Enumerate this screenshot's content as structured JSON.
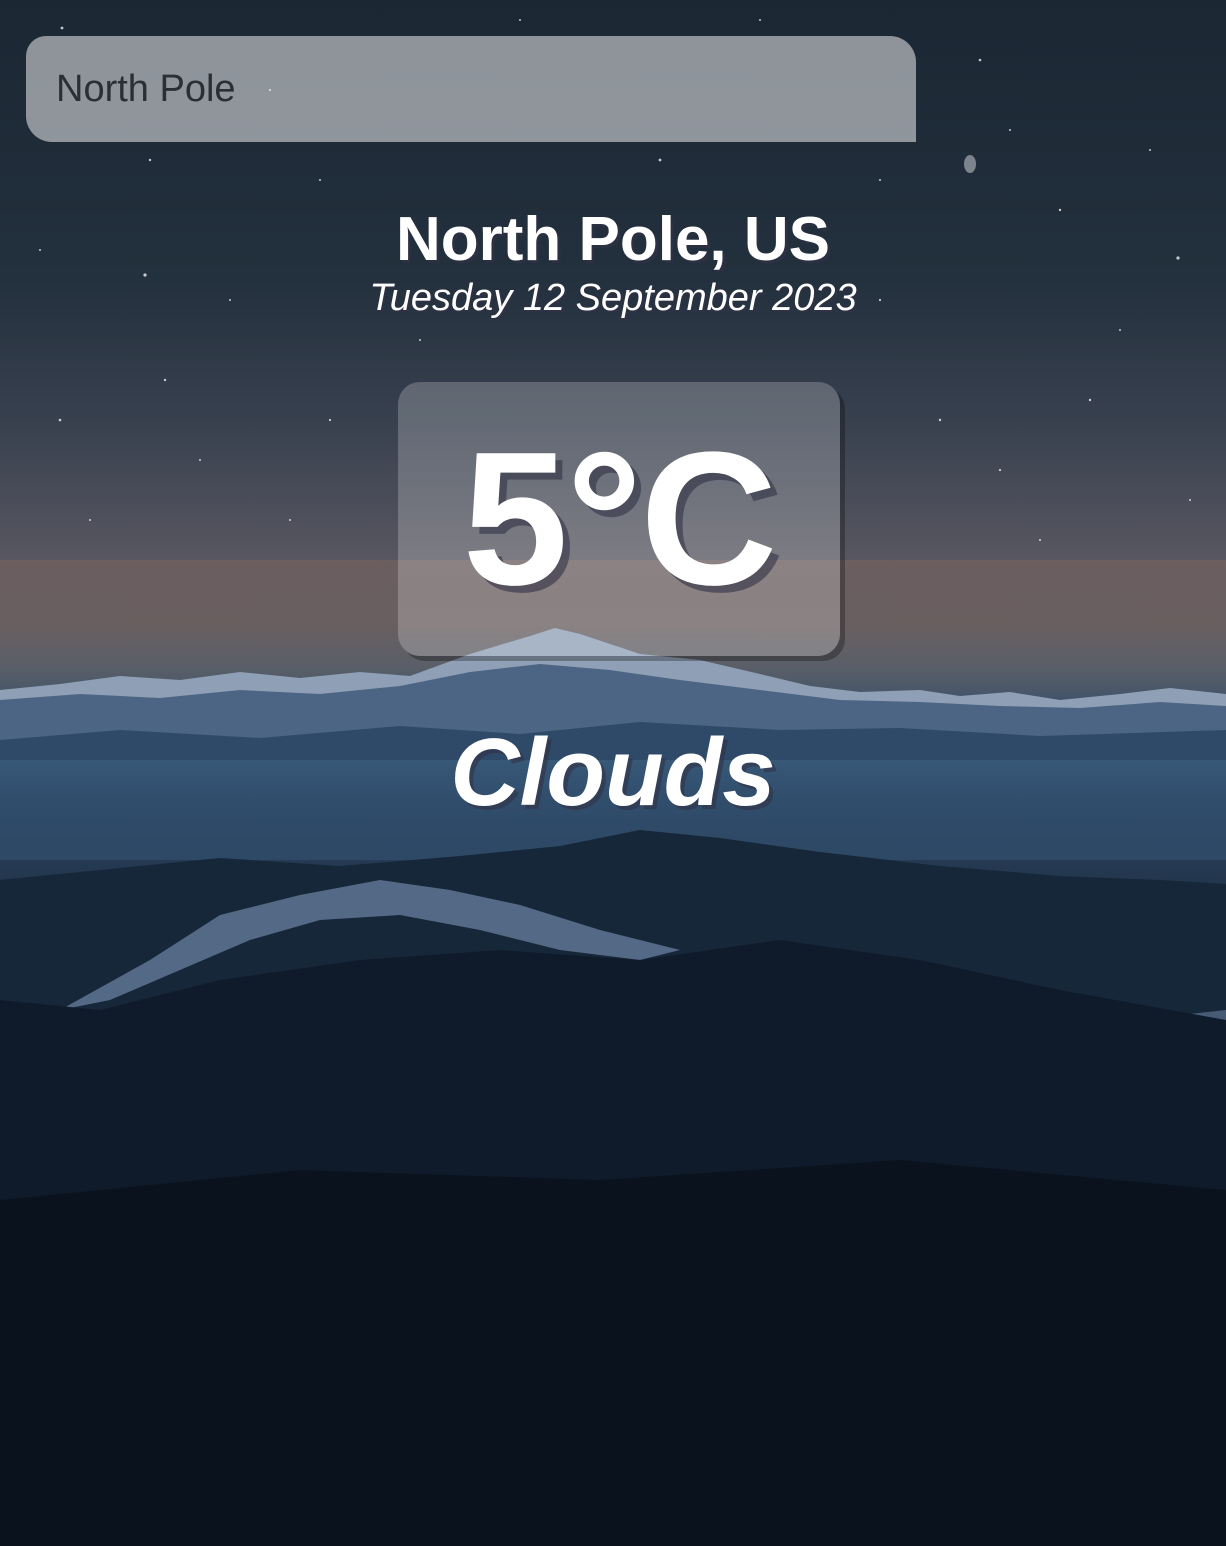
{
  "search": {
    "value": "North Pole"
  },
  "location": {
    "name": "North Pole, US",
    "date": "Tuesday 12 September 2023"
  },
  "weather": {
    "temperature": "5°C",
    "condition": "Clouds"
  }
}
